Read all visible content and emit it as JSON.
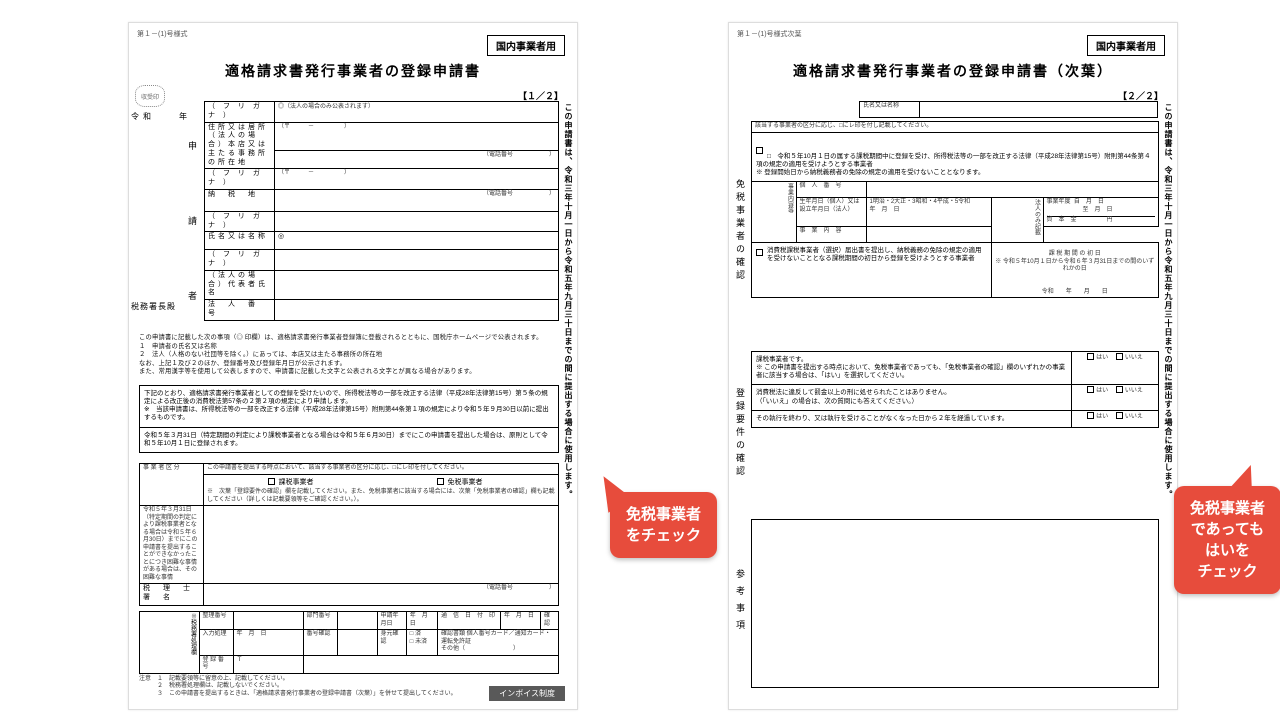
{
  "left": {
    "formcode": "第１－(1)号様式",
    "tag": "国内事業者用",
    "title": "適格請求書発行事業者の登録申請書",
    "pagenum": "【１／２】",
    "vnote": "この申請書は、令和三年十月一日から令和五年九月三十日までの間に提出する場合に使用します。",
    "stamp": "収受印",
    "date": "令和　　年　　月　　日",
    "addr": "税務署長殿",
    "vcol_applicant": "申　　　　請　　　　者",
    "rows": {
      "furigana1": "（ フ リ ガ ナ ）",
      "address": "住所又は居所（法人の場合）本店又は主たる事務所の所在地",
      "addr_note": "◎（法人の場合のみ公表されます）",
      "addr_sub": "（〒　　　－　　　　　）",
      "tel": "（電話番号　　　　　　）",
      "furigana2": "（ フ リ ガ ナ ）",
      "nouzeichi": "納　税　地",
      "furigana3": "（ フ リ ガ ナ ）",
      "name": "氏名又は名称",
      "name_mark": "◎",
      "furigana4": "（ フ リ ガ ナ ）",
      "rep": "（法人の場合）代表者氏名",
      "corpnum": "法　人　番　号"
    },
    "notes": "この申請書に記載した次の事項（◎ 印欄）は、適格請求書発行事業者登録簿に登載されるとともに、国税庁ホームページで公表されます。\n１　申請者の氏名又は名称\n２　法人（人格のない社団等を除く。）にあっては、本店又は主たる事務所の所在地\nなお、上記１及び２のほか、登録番号及び登録年月日が公示されます。\nまた、常用漢字等を使用して公表しますので、申請書に記載した文字と公表される文字とが異なる場合があります。",
    "body1": "下記のとおり、適格請求書発行事業者としての登録を受けたいので、所得税法等の一部を改正する法律（平成28年法律第15号）第５条の規定による改正後の消費税法第57条の２第２項の規定により申請します。\n※　当該申請書は、所得税法等の一部を改正する法律（平成28年法律第15号）附則第44条第１項の規定により令和５年９月30日以前に提出するものです。",
    "body2": "令和５年３月31日（特定期間の判定により課税事業者となる場合は令和５年６月30日）までにこの申請書を提出した場合は、原則として令和５年10月１日に登録されます。",
    "kubun_head": "この申請書を提出する時点において、該当する事業者の区分に応じ、□にレ印を付してください。",
    "kubun_label": "事 業 者 区 分",
    "kubun_kazei": "課税事業者",
    "kubun_menzei": "免税事業者",
    "kubun_note": "※　次葉「登録要件の確認」欄を記載してください。また、免税事業者に該当する場合には、次葉「免税事業者の確認」欄も記載してください（詳しくは記載要領等をご確認ください。）。",
    "reason_head": "令和５年３月31日（特定期間の判定により課税事業者となる場合は令和５年６月30日）までにこの申請書を提出することができなかったことにつき困難な事情がある場合は、その困難な事情",
    "zeirishi": "税　理　士　署　名",
    "bottom": {
      "seiri": "整理番号",
      "bumon": "部門番号",
      "sinsei": "申請年月日",
      "tsuushin": "通　信　日　付　印",
      "kakunin": "確認",
      "nyuuroku": "入力処理",
      "nengappi": "年　月　日",
      "bangou_kakunin": "番号確認",
      "mimoto": "身元確認",
      "sumi": "□ 済\n□ 未済",
      "shorui": "確認書類  個人番号カード／通知カード・運転免許証\nその他（　　　　　　　　）",
      "touroku": "登 録 番 号",
      "t": "Ｔ"
    },
    "footnotes": "注意　１　記載要領等に留意の上、記載してください。\n　　　２　税務署処理欄は、記載しないでください。\n　　　３　この申請書を提出するときは、「適格請求書発行事業者の登録申請書（次葉）」を併せて提出してください。",
    "invoice": "インボイス制度"
  },
  "right": {
    "formcode": "第１－(1)号様式次葉",
    "tag": "国内事業者用",
    "title": "適格請求書発行事業者の登録申請書（次葉）",
    "pagenum": "【２／２】",
    "vnote": "この申請書は、令和三年十月一日から令和五年九月三十日までの間に提出する場合に使用します。",
    "name_label": "氏名又は名称",
    "kubun_note": "該当する事業者の区分に応じ、□にレ印を付し記載してください。",
    "vcol_menzei": "免税事業者の確認",
    "menzei_block1": "□　令和５年10月１日の属する課税期間中に登録を受け、所得税法等の一部を改正する法律（平成28年法律第15号）附則第44条第４項の規定の適用を受けようとする事業者\n※  登録開始日から納税義務者の免除の規定の適用を受けないこととなります。",
    "kojin": "個　人　番　号",
    "jigyou_label": "事業内容等",
    "birth_label": "生年月日（個人）又は設立年月日（法人）",
    "era": "1明治・2大正・3昭和・4平成・5令和",
    "houjin_nomi": "法人のみ記載",
    "nendo": "事業年度",
    "shihon": "資　本　金",
    "jigyounaiyou": "事　業　内　容",
    "menzei_block2_head": "消費税課税事業者（選択）届出書を提出し、納税義務の免除の規定の適用を受けないこととなる課税期間の初日から登録を受けようとする事業者",
    "menzei_block2_sub": "課 税 期 間 の 初 日\n※ 令和５年10月１日から令和６年３月31日までの間のいずれかの日",
    "reiwa_date": "令和　　年　　月　　日",
    "vcol_youken": "登録要件の確認",
    "y1": "課税事業者です。\n※ この申請書を提出する時点において、免税事業者であっても、「免税事業者の確認」欄のいずれかの事業者に該当する場合は、「はい」を選択してください。",
    "y2": "消費税法に違反して罰金以上の刑に処せられたことはありません。\n（「いいえ」の場合は、次の質問にも答えてください。）",
    "y3": "その執行を終わり、又は執行を受けることがなくなった日から２年を経過しています。",
    "hai": "はい",
    "iie": "いいえ",
    "vcol_sankou": "参考事項"
  },
  "callouts": {
    "c1_line1": "免税事業者",
    "c1_line2": "をチェック",
    "c2_line1": "免税事業者",
    "c2_line2": "であっても",
    "c2_line3": "はいを",
    "c2_line4": "チェック"
  }
}
